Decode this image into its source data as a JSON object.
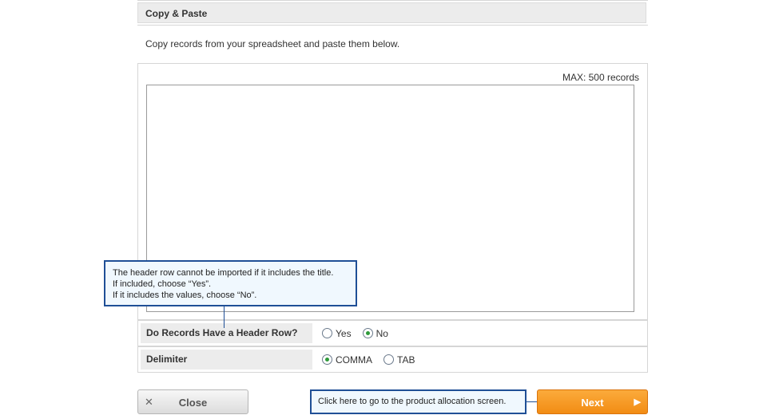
{
  "section": {
    "title": "Copy & Paste",
    "description": "Copy records from your spreadsheet and paste them below."
  },
  "paste": {
    "max_label": "MAX: 500 records",
    "value": ""
  },
  "options": {
    "header_row": {
      "label": "Do Records Have a Header Row?",
      "choices": [
        "Yes",
        "No"
      ],
      "selected": "No"
    },
    "delimiter": {
      "label": "Delimiter",
      "choices": [
        "COMMA",
        "TAB"
      ],
      "selected": "COMMA"
    }
  },
  "callouts": {
    "header_help": {
      "line1": "The header row cannot be imported if it includes the title.",
      "line2": "If included, choose “Yes”.",
      "line3": "If it includes the values, choose “No”."
    },
    "next_help": "Click here to go to the product allocation screen."
  },
  "buttons": {
    "close_label": "Close",
    "next_label": "Next"
  },
  "icons": {
    "close": "x-icon",
    "next": "play-arrow-icon"
  },
  "colors": {
    "accent_orange": "#f28c14",
    "callout_border": "#1f4f96",
    "radio_checked": "#2e9a3a"
  }
}
